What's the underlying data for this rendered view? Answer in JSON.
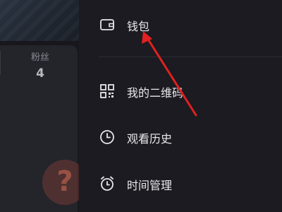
{
  "profile": {
    "stat_label": "粉丝",
    "stat_value": "4",
    "watermark_icon": "?"
  },
  "menu": {
    "items": [
      {
        "id": "wallet",
        "label": "钱包",
        "icon": "wallet-icon"
      },
      {
        "id": "qrcode",
        "label": "我的二维码",
        "icon": "qr-code-icon"
      },
      {
        "id": "history",
        "label": "观看历史",
        "icon": "clock-icon"
      },
      {
        "id": "time",
        "label": "时间管理",
        "icon": "alarm-clock-icon"
      }
    ]
  },
  "annotation": {
    "color": "#e0211f"
  },
  "colors": {
    "background": "#1b1b21",
    "text": "#e8e8ec",
    "icon": "#e6e6ea"
  }
}
